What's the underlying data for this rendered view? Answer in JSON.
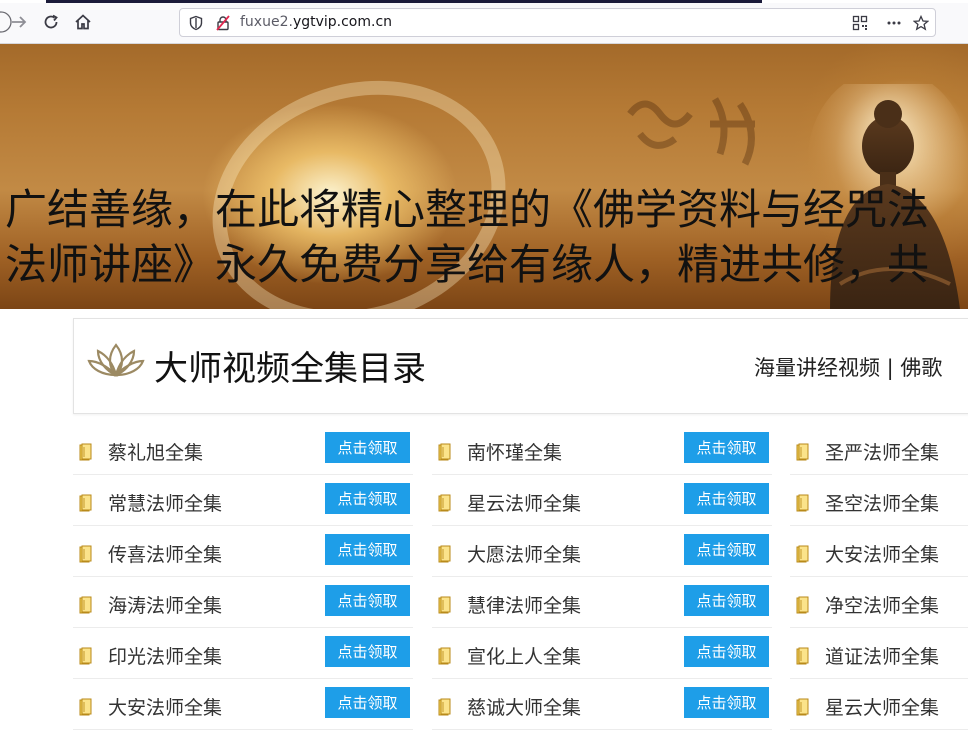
{
  "browser": {
    "url_prefix": "fuxue2.",
    "url_host": "ygtvip.com.cn"
  },
  "banner": {
    "line1": "广结善缘，在此将精心整理的《佛学资料与经咒法",
    "line2": "法师讲座》永久免费分享给有缘人，精进共修，共"
  },
  "section": {
    "title": "大师视频全集目录",
    "subtitle": "海量讲经视频 | 佛歌"
  },
  "claim_label": "点击领取",
  "columns": [
    [
      "蔡礼旭全集",
      "常慧法师全集",
      "传喜法师全集",
      "海涛法师全集",
      "印光法师全集",
      "大安法师全集"
    ],
    [
      "南怀瑾全集",
      "星云法师全集",
      "大愿法师全集",
      "慧律法师全集",
      "宣化上人全集",
      "慈诚大师全集"
    ],
    [
      "圣严法师全集",
      "圣空法师全集",
      "大安法师全集",
      "净空法师全集",
      "道证法师全集",
      "星云大师全集"
    ]
  ],
  "colors": {
    "button_blue": "#1e9ee8",
    "banner_brown": "#b57a35"
  }
}
